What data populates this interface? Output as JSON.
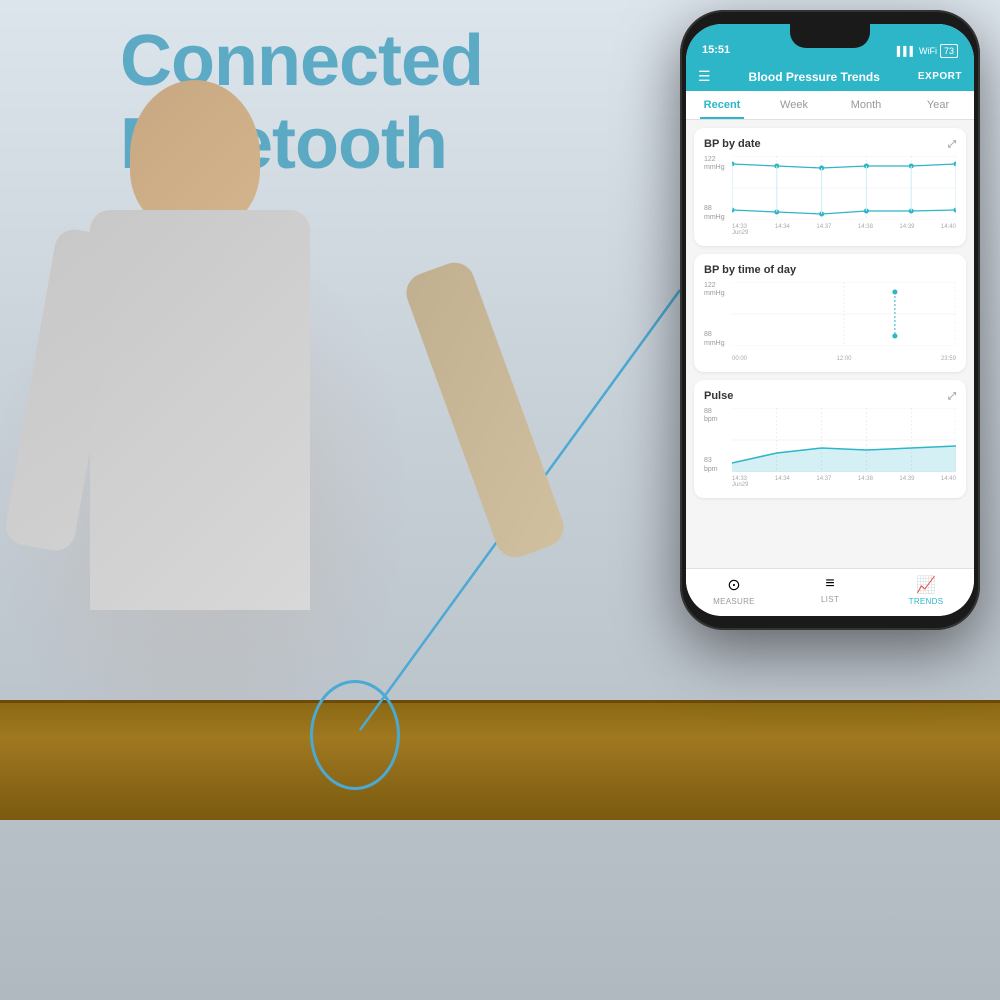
{
  "background": {
    "text_line1": "Connected",
    "text_line2": "Bluetooth"
  },
  "phone": {
    "status_bar": {
      "time": "15:51",
      "battery": "73"
    },
    "header": {
      "menu_icon": "☰",
      "title": "Blood Pressure Trends",
      "export_label": "EXPORT"
    },
    "tabs": [
      {
        "label": "Recent",
        "active": true
      },
      {
        "label": "Week",
        "active": false
      },
      {
        "label": "Month",
        "active": false
      },
      {
        "label": "Year",
        "active": false
      }
    ],
    "charts": [
      {
        "id": "bp-date",
        "title": "BP by date",
        "y_top": "122\nmmHg",
        "y_bottom": "88\nmmHg",
        "x_labels": [
          "14:33\nJun29",
          "14:34",
          "14:37",
          "14:38",
          "14:39",
          "14:40"
        ],
        "has_expand": true
      },
      {
        "id": "bp-time",
        "title": "BP by time of day",
        "y_top": "122\nmmHg",
        "y_bottom": "88\nmmHg",
        "x_labels": [
          "00:00",
          "12:00",
          "23:59"
        ],
        "has_expand": false
      },
      {
        "id": "pulse",
        "title": "Pulse",
        "y_top": "88\nbpm",
        "y_bottom": "83\nbpm",
        "x_labels": [
          "14:33\nJun29",
          "14:34",
          "14:37",
          "14:38",
          "14:39",
          "14:40"
        ],
        "has_expand": true
      }
    ],
    "bottom_nav": [
      {
        "icon": "⊙",
        "label": "MEASURE",
        "active": false
      },
      {
        "icon": "☰",
        "label": "LIST",
        "active": false
      },
      {
        "icon": "📈",
        "label": "TRENDS",
        "active": true
      }
    ]
  }
}
